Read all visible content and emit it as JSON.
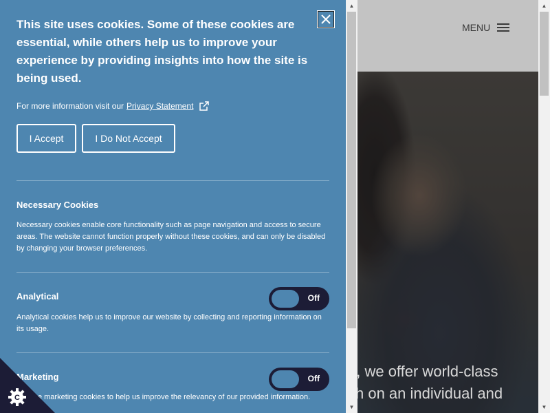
{
  "site": {
    "menu_label": "MENU",
    "hero_text_line1": "o, we offer world-class",
    "hero_text_line2": "ch on an individual and"
  },
  "cookie_panel": {
    "title": "This site uses cookies. Some of these cookies are essential, while others help us to improve your experience by providing insights into how the site is being used.",
    "more_info_text": "For more information visit our",
    "privacy_link": "Privacy Statement",
    "accept_label": "I Accept",
    "decline_label": "I Do Not Accept",
    "sections": [
      {
        "title": "Necessary Cookies",
        "description": "Necessary cookies enable core functionality such as page navigation and access to secure areas. The website cannot function properly without these cookies, and can only be disabled by changing your browser preferences."
      },
      {
        "title": "Analytical",
        "description": "Analytical cookies help us to improve our website by collecting and reporting information on its usage.",
        "toggle_state": "Off"
      },
      {
        "title": "Marketing",
        "description": "We use marketing cookies to help us improve the relevancy of our provided information.",
        "toggle_state": "Off"
      }
    ]
  },
  "colors": {
    "panel_bg": "#4e86b0",
    "toggle_bg": "#1c1c36",
    "header_bg": "#c3c3c3"
  },
  "icons": [
    "close-icon",
    "external-link-icon",
    "hamburger-icon",
    "cookie-settings-icon",
    "scroll-up-icon",
    "scroll-down-icon"
  ]
}
